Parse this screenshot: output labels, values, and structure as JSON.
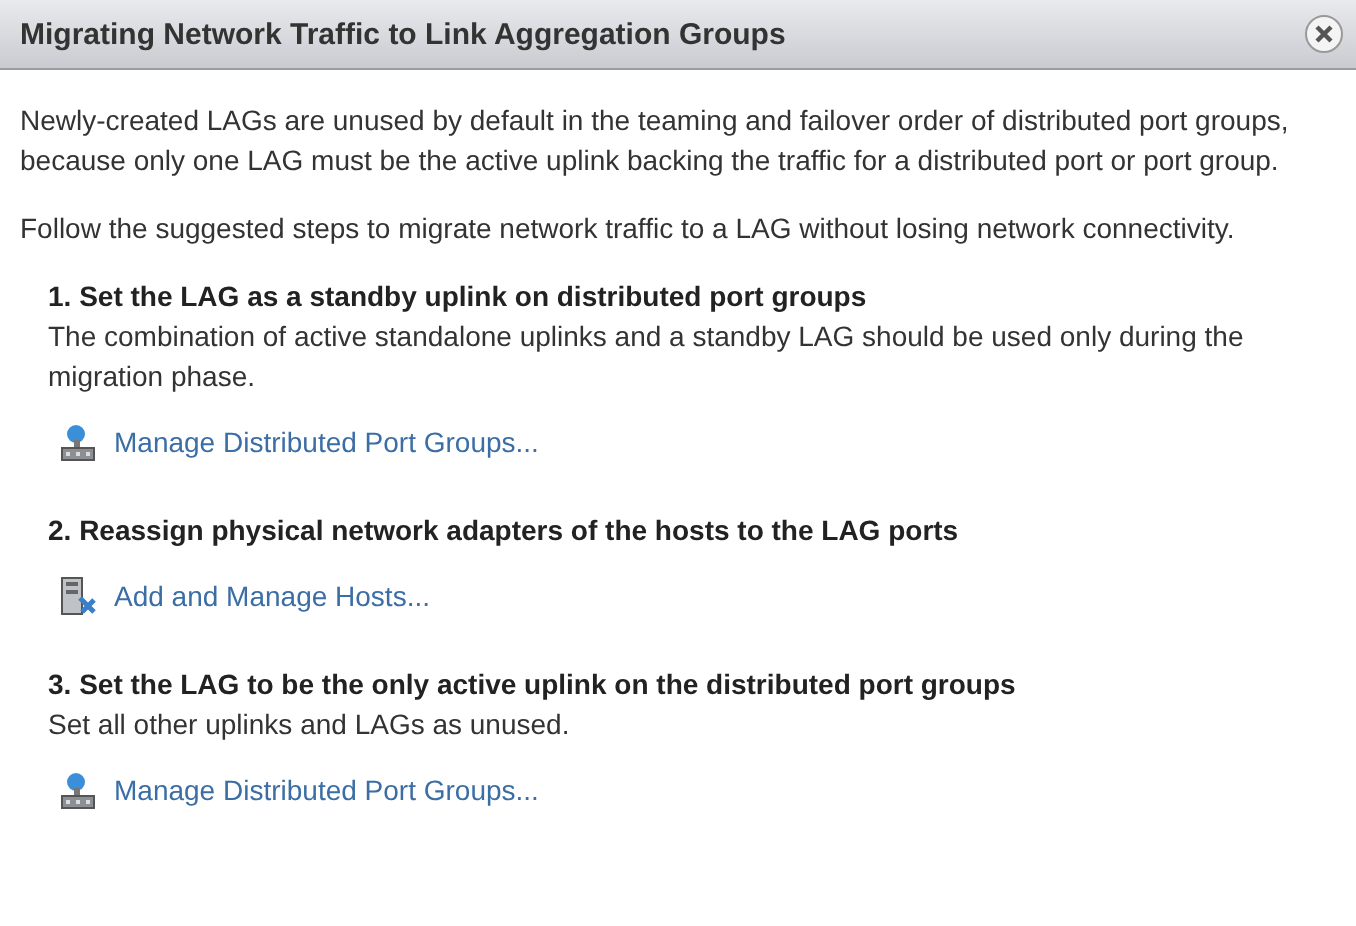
{
  "window": {
    "title": "Migrating Network Traffic to Link Aggregation Groups"
  },
  "intro": [
    "Newly-created LAGs are unused by default in the teaming and failover order of distributed port groups, because only one LAG must be the active uplink backing the traffic for a distributed port or port group.",
    "Follow the suggested steps to migrate network traffic to a LAG without losing network connectivity."
  ],
  "steps": [
    {
      "heading": "1. Set the LAG as a standby uplink on distributed port groups",
      "description": "The combination of active standalone uplinks and a standby LAG should be used only during the migration phase.",
      "link": {
        "kind": "port-groups",
        "label": "Manage Distributed Port Groups..."
      }
    },
    {
      "heading": "2. Reassign physical network adapters of the hosts to the LAG ports",
      "link": {
        "kind": "hosts",
        "label": "Add and Manage Hosts..."
      }
    },
    {
      "heading": "3. Set the LAG to be the only active uplink on the distributed port groups",
      "description": "Set all other uplinks and LAGs as unused.",
      "link": {
        "kind": "port-groups",
        "label": "Manage Distributed Port Groups..."
      }
    }
  ]
}
